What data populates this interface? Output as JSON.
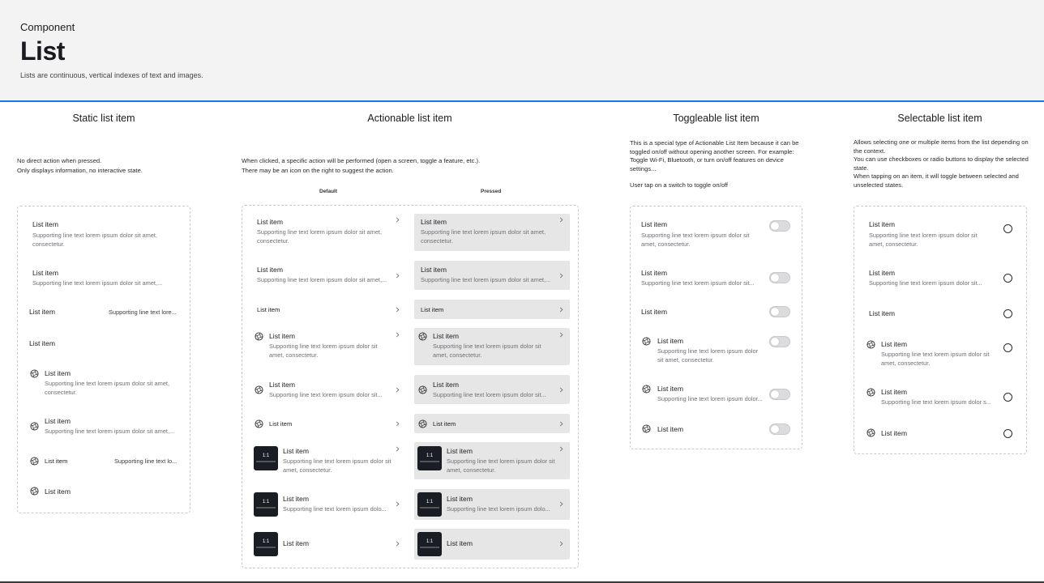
{
  "header": {
    "eyebrow": "Component",
    "title": "List",
    "description": "Lists are continuous, vertical indexes of text and images."
  },
  "colors": {
    "accent": "#1a73e8",
    "pressed_bg": "#e6e6e7",
    "thumbnail": "#1b1d24"
  },
  "icons": {
    "leading": "aperture-icon",
    "trailing": "chevron-right-icon",
    "thumbnail": "image-thumbnail"
  },
  "static": {
    "title": "Static list item",
    "desc": [
      "No direct action when pressed.",
      "Only displays information, no interactive state."
    ],
    "item_label": "List item",
    "support_two_line": "Supporting line text lorem ipsum dolor sit amet, consectetur.",
    "support_one_line": "Supporting line text lorem ipsum dolor sit amet,...",
    "trailing_short_a": "Supporting line text lore...",
    "trailing_short_b": "Supporting line text lo..."
  },
  "actionable": {
    "title": "Actionable list item",
    "desc": [
      "When clicked, a specific action will be performed (open a screen, toggle a feature, etc.).",
      "There may be an icon on the right to suggest the action."
    ],
    "col_default": "Default",
    "col_pressed": "Pressed",
    "item_label": "List item",
    "support_two_line": "Supporting line text lorem ipsum dolor sit amet, consectetur.",
    "support_one_line": "Supporting line text lorem ipsum dolor sit amet,...",
    "support_one_line_icon": "Supporting line text lorem ipsum dolor sit...",
    "support_two_line_icon": "Supporting line text lorem ipsum dolor sit amet, consectetur.",
    "support_two_line_thumb": "Supporting line text lorem ipsum dolor sit amet, consectetur.",
    "support_one_line_thumb": "Supporting line text lorem ipsum dolo...",
    "thumb_ratio": "1:1"
  },
  "toggleable": {
    "title": "Toggleable list item",
    "desc": [
      "This is a special type of Actionable List Item because it can be toggled on/off without opening another screen. For example: Toggle Wi-Fi, Bluetooth, or turn on/off features on device settings...",
      "",
      "User tap on a switch to toggle on/off"
    ],
    "item_label": "List item",
    "support_two_line": "Supporting line text lorem ipsum dolor sit amet, consectetur.",
    "support_one_line": "Supporting line text lorem ipsum dolor sit...",
    "support_two_line_icon": "Supporting line text lorem ipsum dolor sit amet, consectetur.",
    "support_one_line_icon": "Supporting line text lorem ipsum dolor..."
  },
  "selectable": {
    "title": "Selectable list item",
    "desc": [
      "Allows selecting one or multiple items from the list depending on the context.",
      "You can use checkboxes or radio buttons to display the selected state.",
      "When tapping on an item, it will toggle between selected and unselected states."
    ],
    "item_label": "List item",
    "support_two_line": "Supporting line text lorem ipsum dolor sit amet, consectetur.",
    "support_one_line": "Supporting line text lorem ipsum dolor sit...",
    "support_two_line_icon": "Supporting line text lorem ipsum dolor sit amet, consectetur.",
    "support_one_line_icon": "Supporting line text lorem ipsum dolor s..."
  }
}
